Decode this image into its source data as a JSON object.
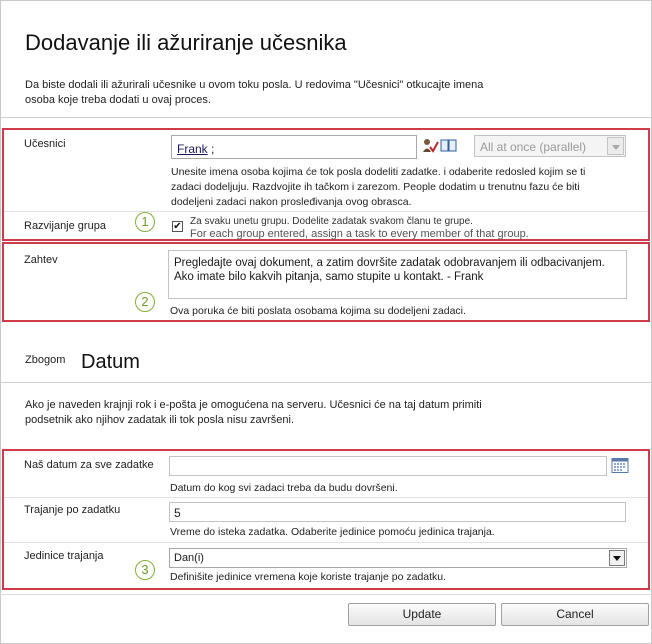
{
  "title": "Dodavanje ili ažuriranje učesnika",
  "intro": "Da biste dodali ili ažurirali učesnike u ovom toku posla. U redovima \"Učesnici\" otkucajte imena osoba koje treba dodati u ovaj proces.",
  "participants": {
    "label": "Učesnici",
    "name": "Frank",
    "separator": ";",
    "order_value": "All at once (parallel)",
    "help": "Unesite imena osoba kojima će tok posla dodeliti zadatke. i odaberite redosled kojim se ti zadaci dodeljuju. Razdvojite ih tačkom i zarezom. People dodatim u trenutnu fazu će biti dodeljeni zadaci nakon prosleđivanja ovog obrasca."
  },
  "group_expansion": {
    "label": "Razvijanje grupa",
    "checked": "✔",
    "text_line1": "Za svaku unetu grupu. Dodelite zadatak svakom članu te grupe.",
    "text_line2": "For each group entered, assign a task to every member of that group."
  },
  "request": {
    "label": "Zahtev",
    "value": "Pregledajte ovaj dokument, a zatim dovršite zadatak odobravanjem ili odbacivanjem. Ako imate bilo kakvih pitanja, samo stupite u kontakt. - Frank",
    "help": "Ova poruka će biti poslata osobama kojima su dodeljeni zadaci."
  },
  "due_section": {
    "title_small": "Zbogom",
    "title_big": "Datum",
    "intro": "Ako je naveden krajnji rok i e-pošta je omogućena na serveru. Učesnici će na taj datum primiti podsetnik ako njihov zadatak ili tok posla nisu završeni."
  },
  "due_date": {
    "label": "Naš datum za sve zadatke",
    "value": "",
    "help": "Datum do kog svi zadaci treba da budu dovršeni."
  },
  "duration": {
    "label": "Trajanje po zadatku",
    "value": "5",
    "help": "Vreme do isteka zadatka. Odaberite jedinice pomoću jedinica trajanja."
  },
  "duration_units": {
    "label": "Jedinice trajanja",
    "value": "Dan(i)",
    "help": "Definišite jedinice vremena koje koriste trajanje po zadatku."
  },
  "callouts": [
    "1",
    "2",
    "3"
  ],
  "buttons": {
    "update": "Update",
    "cancel": "Cancel"
  },
  "colors": {
    "highlight_border": "#d03a4a",
    "callout": "#7fb23a"
  },
  "icons": {
    "check_names": "check-names-icon",
    "address_book": "address-book-icon",
    "calendar": "calendar-icon"
  }
}
